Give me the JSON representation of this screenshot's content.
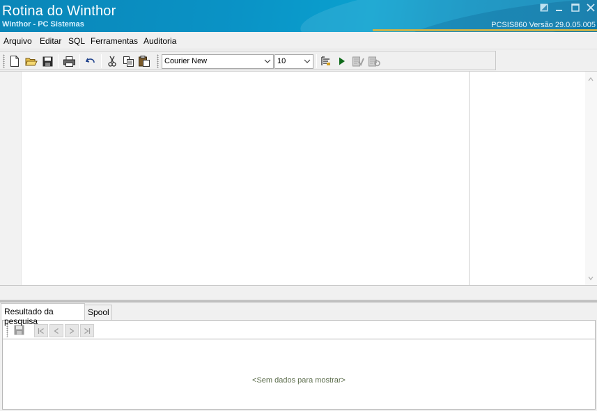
{
  "window": {
    "title": "Rotina do Winthor",
    "subtitle": "Winthor - PC Sistemas",
    "version": "PCSIS860  Versão  29.0.05.005"
  },
  "menu": {
    "items": [
      "Arquivo",
      "Editar",
      "SQL",
      "Ferramentas",
      "Auditoria"
    ]
  },
  "toolbar": {
    "font_name": "Courier New",
    "font_size": "10",
    "buttons": [
      "new-file-icon",
      "open-folder-icon",
      "save-icon",
      "print-icon",
      "undo-icon",
      "cut-icon",
      "copy-icon",
      "paste-icon",
      "query-icon",
      "run-icon",
      "commit-icon",
      "rollback-icon"
    ]
  },
  "tabs": [
    {
      "label": "Resultado da pesquisa",
      "active": true
    },
    {
      "label": "Spool",
      "active": false
    }
  ],
  "results": {
    "empty_message": "<Sem dados para mostrar>"
  },
  "colors": {
    "title_bar": "#0a93c6",
    "accent_line": "#c9b24a",
    "empty_text": "#5a6b4a"
  }
}
